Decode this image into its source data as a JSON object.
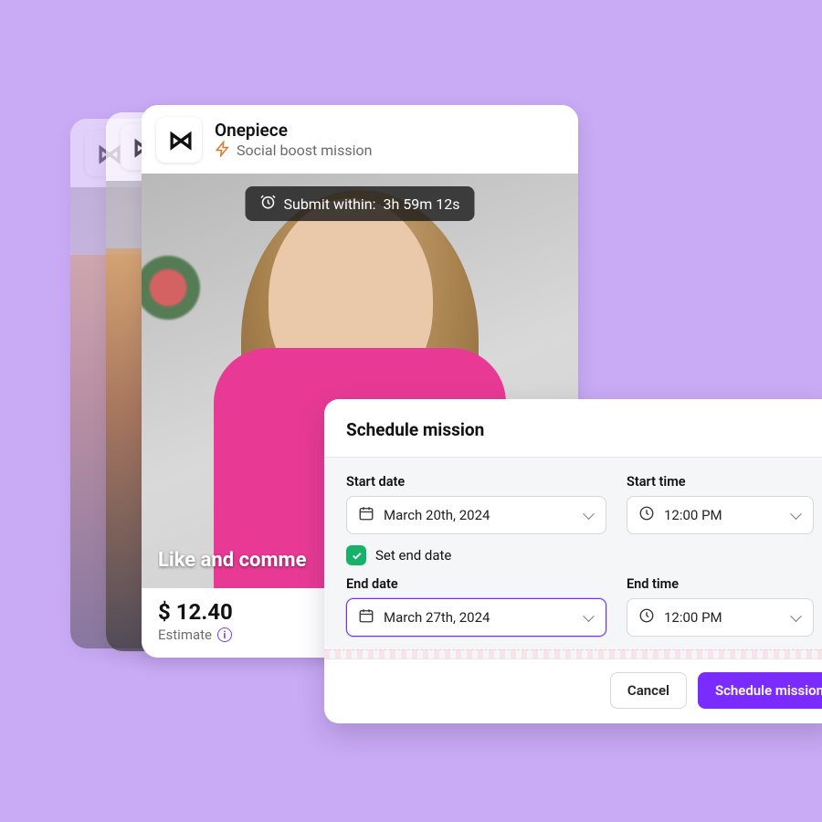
{
  "card": {
    "brand_name": "Onepiece",
    "mission_type": "Social boost mission",
    "countdown_label": "Submit within:",
    "countdown_value": "3h 59m 12s",
    "caption": "Like and comme",
    "price": "$ 12.40",
    "estimate_label": "Estimate",
    "logo_glyph": "⋈"
  },
  "modal": {
    "title": "Schedule mission",
    "start_date_label": "Start date",
    "start_date_value": "March 20th, 2024",
    "start_time_label": "Start time",
    "start_time_value": "12:00 PM",
    "set_end_label": "Set end date",
    "set_end_checked": true,
    "end_date_label": "End date",
    "end_date_value": "March 27th, 2024",
    "end_time_label": "End time",
    "end_time_value": "12:00 PM",
    "cancel_label": "Cancel",
    "submit_label": "Schedule mission"
  },
  "colors": {
    "accent": "#7a2cff",
    "success": "#17b26a"
  }
}
